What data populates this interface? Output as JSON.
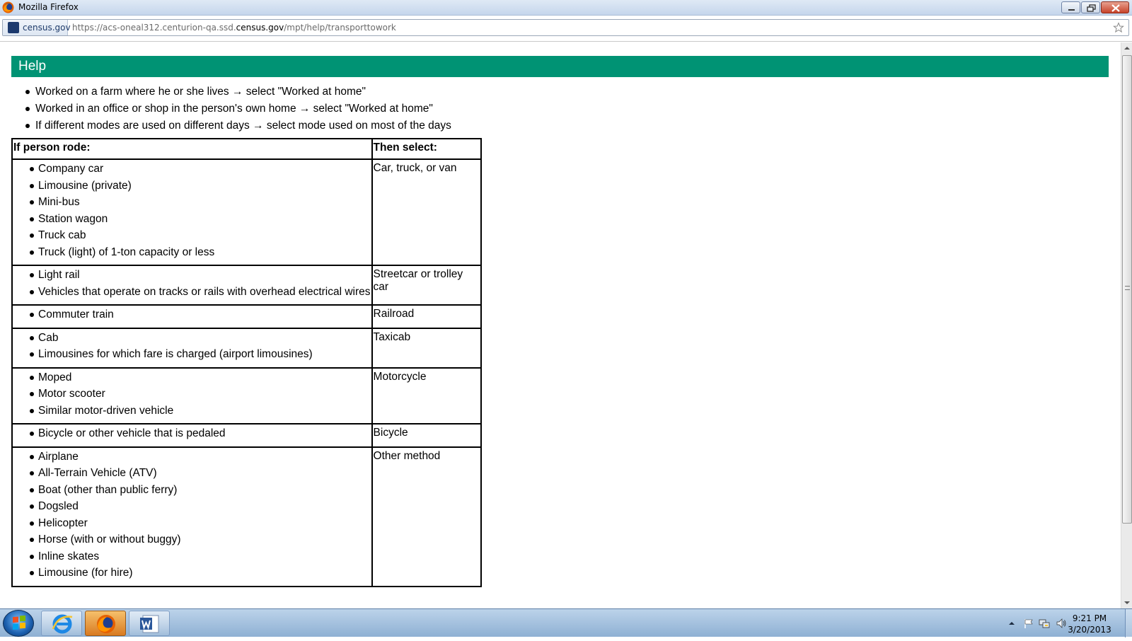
{
  "window": {
    "title": "Mozilla Firefox"
  },
  "address_bar": {
    "identity_label": "census.gov",
    "url_prefix": "https://acs-oneal312.centurion-qa.ssd.",
    "url_host": "census.gov",
    "url_path": "/mpt/help/transporttowork"
  },
  "page": {
    "header_title": "Help",
    "intro_items": [
      "Worked on a farm where he or she lives → select \"Worked at home\"",
      "Worked in an office or shop in the person's own home → select \"Worked at home\"",
      "If different modes are used on different days → select mode used on most of the days"
    ],
    "table": {
      "headers": [
        "If person rode:",
        "Then select:"
      ],
      "rows": [
        {
          "items": [
            "Company car",
            "Limousine (private)",
            "Mini-bus",
            "Station wagon",
            "Truck cab",
            "Truck (light) of 1-ton capacity or less"
          ],
          "select": "Car, truck, or van"
        },
        {
          "items": [
            "Light rail",
            "Vehicles that operate on tracks or rails with overhead electrical wires"
          ],
          "select": "Streetcar or trolley car"
        },
        {
          "items": [
            "Commuter train"
          ],
          "select": "Railroad"
        },
        {
          "items": [
            "Cab",
            "Limousines for which fare is charged (airport limousines)"
          ],
          "select": "Taxicab"
        },
        {
          "items": [
            "Moped",
            "Motor scooter",
            "Similar motor-driven vehicle"
          ],
          "select": "Motorcycle"
        },
        {
          "items": [
            "Bicycle or other vehicle that is pedaled"
          ],
          "select": "Bicycle"
        },
        {
          "items": [
            "Airplane",
            "All-Terrain Vehicle (ATV)",
            "Boat (other than public ferry)",
            "Dogsled",
            "Helicopter",
            "Horse (with or without buggy)",
            "Inline skates",
            "Limousine (for hire)"
          ],
          "select": "Other method"
        }
      ]
    }
  },
  "taskbar": {
    "clock_time": "9:21 PM",
    "clock_date": "3/20/2013",
    "pinned": [
      "internet-explorer-icon",
      "firefox-icon",
      "word-icon"
    ]
  },
  "colors": {
    "help_header_bg": "#009374",
    "taskbar_bg": "#a9c4e0"
  }
}
